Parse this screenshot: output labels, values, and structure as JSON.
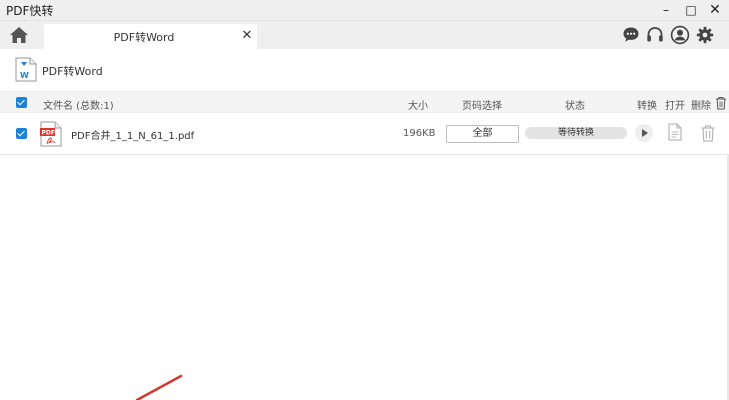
{
  "app": {
    "title": "PDF快转",
    "window_controls": {
      "minimize": "–",
      "maximize": "□",
      "close": "✕"
    }
  },
  "tabs": [
    {
      "label": "PDF转Word",
      "close": "✕",
      "active": true
    }
  ],
  "toolbar_icons": [
    "home-icon",
    "chat-icon",
    "headset-icon",
    "user-icon",
    "gear-icon"
  ],
  "document": {
    "title": "PDF转Word"
  },
  "table": {
    "headers": {
      "filename": "文件名 (总数:1)",
      "size": "大小",
      "pages": "页码选择",
      "status": "状态",
      "convert": "转换",
      "open": "打开",
      "delete": "删除"
    },
    "rows": [
      {
        "checked": true,
        "name": "PDF合并_1_1_N_61_1.pdf",
        "size": "196KB",
        "pages": "全部",
        "status": "等待转换"
      }
    ]
  },
  "colors": {
    "accent": "#1e82d8",
    "pdf_red": "#d9362b",
    "annotation_red": "#d03a2c"
  }
}
